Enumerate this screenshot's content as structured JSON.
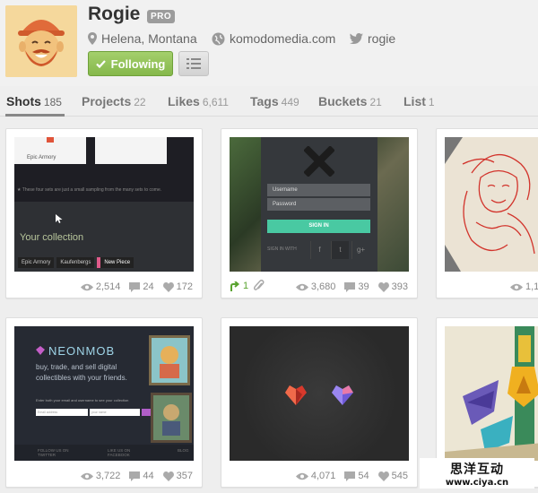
{
  "profile": {
    "name": "Rogie",
    "badge": "PRO",
    "location": "Helena, Montana",
    "website": "komodomedia.com",
    "twitter": "rogie",
    "following_label": "Following"
  },
  "tabs": [
    {
      "label": "Shots",
      "count": "185",
      "active": true
    },
    {
      "label": "Projects",
      "count": "22"
    },
    {
      "label": "Likes",
      "count": "6,611"
    },
    {
      "label": "Tags",
      "count": "449"
    },
    {
      "label": "Buckets",
      "count": "21"
    },
    {
      "label": "List",
      "count": "1"
    }
  ],
  "shots": [
    {
      "views": "2,514",
      "comments": "24",
      "likes": "172",
      "thumb": {
        "paper_label": "Epic Armory",
        "tiny_text": "★ These four sets are just a small sampling from the many sets to come.",
        "collection": "Your collection",
        "chips": [
          "Epic Armory",
          "Kaufenbergs",
          "New Piece"
        ]
      }
    },
    {
      "rebounds": "1",
      "views": "3,680",
      "comments": "39",
      "likes": "393",
      "thumb": {
        "username": "Username",
        "password": "Password",
        "signin": "SIGN IN",
        "signin_with": "SIGN IN WITH",
        "social": [
          "f",
          "t",
          "g+"
        ]
      }
    },
    {
      "views": "1,1"
    },
    {
      "views": "3,722",
      "comments": "44",
      "likes": "357",
      "thumb": {
        "brand": "NEONMOB",
        "tagline": "buy, trade, and sell digital collectibles with your friends.",
        "small": "Enter both your email and username to see your collection",
        "email_placeholder": "Email address",
        "username_placeholder": "your name",
        "footer_left": "FOLLOW US ON TWITTER",
        "footer_mid": "LIKE US ON FACEBOOK",
        "footer_right": "BLOG"
      }
    },
    {
      "views": "4,071",
      "comments": "54",
      "likes": "545"
    }
  ],
  "watermark": {
    "cn": "思洋互动",
    "url": "www.ciya.cn"
  },
  "colors": {
    "following_green": "#85b84b",
    "signin_teal": "#49c9a2",
    "neon_accent": "#b05ec8"
  }
}
